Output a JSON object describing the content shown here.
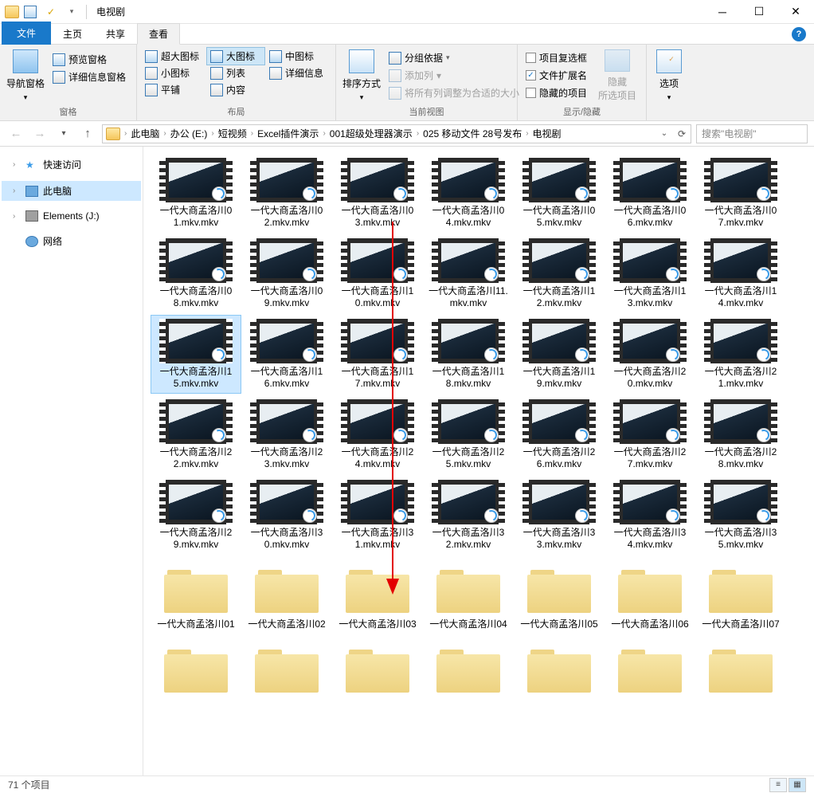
{
  "title": "电视剧",
  "tabs": {
    "file": "文件",
    "home": "主页",
    "share": "共享",
    "view": "查看"
  },
  "ribbon": {
    "panes": {
      "navpane": "导航窗格",
      "preview": "预览窗格",
      "details": "详细信息窗格",
      "group": "窗格"
    },
    "layout": {
      "xl": "超大图标",
      "lg": "大图标",
      "md": "中图标",
      "sm": "小图标",
      "list": "列表",
      "detail": "详细信息",
      "tiles": "平铺",
      "content": "内容",
      "group": "布局"
    },
    "sort": {
      "btn": "排序方式",
      "group_by": "分组依据",
      "add_cols": "添加列",
      "autosize": "将所有列调整为合适的大小",
      "group": "当前视图"
    },
    "showhide": {
      "checkboxes": "项目复选框",
      "ext": "文件扩展名",
      "hidden": "隐藏的项目",
      "hide_btn": "隐藏\n所选项目",
      "group": "显示/隐藏"
    },
    "options": {
      "btn": "选项"
    }
  },
  "breadcrumb": [
    "此电脑",
    "办公 (E:)",
    "短视频",
    "Excel插件演示",
    "001超级处理器演示",
    "025 移动文件 28号发布",
    "电视剧"
  ],
  "search_placeholder": "搜索\"电视剧\"",
  "tree": {
    "quick": "快速访问",
    "thispc": "此电脑",
    "elements": "Elements (J:)",
    "network": "网络"
  },
  "videos": [
    "一代大商孟洛川01.mkv.mkv",
    "一代大商孟洛川02.mkv.mkv",
    "一代大商孟洛川03.mkv.mkv",
    "一代大商孟洛川04.mkv.mkv",
    "一代大商孟洛川05.mkv.mkv",
    "一代大商孟洛川06.mkv.mkv",
    "一代大商孟洛川07.mkv.mkv",
    "一代大商孟洛川08.mkv.mkv",
    "一代大商孟洛川09.mkv.mkv",
    "一代大商孟洛川10.mkv.mkv",
    "一代大商孟洛川11.mkv.mkv",
    "一代大商孟洛川12.mkv.mkv",
    "一代大商孟洛川13.mkv.mkv",
    "一代大商孟洛川14.mkv.mkv",
    "一代大商孟洛川15.mkv.mkv",
    "一代大商孟洛川16.mkv.mkv",
    "一代大商孟洛川17.mkv.mkv",
    "一代大商孟洛川18.mkv.mkv",
    "一代大商孟洛川19.mkv.mkv",
    "一代大商孟洛川20.mkv.mkv",
    "一代大商孟洛川21.mkv.mkv",
    "一代大商孟洛川22.mkv.mkv",
    "一代大商孟洛川23.mkv.mkv",
    "一代大商孟洛川24.mkv.mkv",
    "一代大商孟洛川25.mkv.mkv",
    "一代大商孟洛川26.mkv.mkv",
    "一代大商孟洛川27.mkv.mkv",
    "一代大商孟洛川28.mkv.mkv",
    "一代大商孟洛川29.mkv.mkv",
    "一代大商孟洛川30.mkv.mkv",
    "一代大商孟洛川31.mkv.mkv",
    "一代大商孟洛川32.mkv.mkv",
    "一代大商孟洛川33.mkv.mkv",
    "一代大商孟洛川34.mkv.mkv",
    "一代大商孟洛川35.mkv.mkv"
  ],
  "folders": [
    "一代大商孟洛川01",
    "一代大商孟洛川02",
    "一代大商孟洛川03",
    "一代大商孟洛川04",
    "一代大商孟洛川05",
    "一代大商孟洛川06",
    "一代大商孟洛川07",
    "",
    "",
    "",
    "",
    "",
    "",
    ""
  ],
  "selected_video_index": 14,
  "status": "71 个项目"
}
